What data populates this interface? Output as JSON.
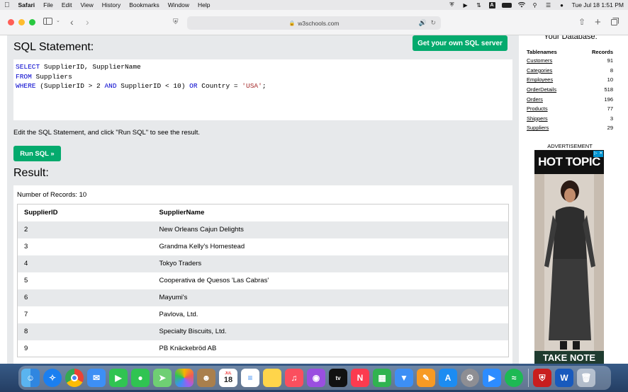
{
  "menubar": {
    "app_name": "Safari",
    "menus": [
      "File",
      "Edit",
      "View",
      "History",
      "Bookmarks",
      "Window",
      "Help"
    ],
    "datetime": "Tue Jul 18  1:51 PM",
    "input_badge": "A"
  },
  "browser": {
    "url": "w3schools.com"
  },
  "page": {
    "sql_title": "SQL Statement:",
    "get_sql_button": "Get your own SQL server",
    "sql_lines": {
      "l1_kw": "SELECT",
      "l1_rest": " SupplierID, SupplierName",
      "l2_kw": "FROM",
      "l2_rest": " Suppliers",
      "l3_kw": "WHERE",
      "l3_a": " (SupplierID > 2 ",
      "l3_and": "AND",
      "l3_b": " SupplierID < 10) ",
      "l3_or": "OR",
      "l3_c": " Country = ",
      "l3_str": "'USA'",
      "l3_end": ";"
    },
    "edit_hint": "Edit the SQL Statement, and click \"Run SQL\" to see the result.",
    "run_button": "Run SQL »",
    "result_title": "Result:",
    "record_count": "Number of Records: 10",
    "result_table": {
      "headers": [
        "SupplierID",
        "SupplierName"
      ],
      "rows": [
        [
          "2",
          "New Orleans Cajun Delights"
        ],
        [
          "3",
          "Grandma Kelly's Homestead"
        ],
        [
          "4",
          "Tokyo Traders"
        ],
        [
          "5",
          "Cooperativa de Quesos 'Las Cabras'"
        ],
        [
          "6",
          "Mayumi's"
        ],
        [
          "7",
          "Pavlova, Ltd."
        ],
        [
          "8",
          "Specialty Biscuits, Ltd."
        ],
        [
          "9",
          "PB Knäckebröd AB"
        ]
      ]
    }
  },
  "sidebar": {
    "title": "Your Database:",
    "headers": [
      "Tablenames",
      "Records"
    ],
    "tables": [
      {
        "name": "Customers",
        "records": "91"
      },
      {
        "name": "Categories",
        "records": "8"
      },
      {
        "name": "Employees",
        "records": "10"
      },
      {
        "name": "OrderDetails",
        "records": "518"
      },
      {
        "name": "Orders",
        "records": "196"
      },
      {
        "name": "Products",
        "records": "77"
      },
      {
        "name": "Shippers",
        "records": "3"
      },
      {
        "name": "Suppliers",
        "records": "29"
      }
    ],
    "ad_label": "ADVERTISEMENT",
    "ad_brand": "HOT TOPIC",
    "ad_bottom_text": "TAKE NOTE"
  },
  "dock": {
    "calendar_day": "18",
    "icons": [
      "finder-icon",
      "safari-icon",
      "chrome-icon",
      "mail-icon",
      "facetime-icon",
      "messages-icon",
      "maps-icon",
      "photos-icon",
      "contacts-icon",
      "calendar-icon",
      "reminders-icon",
      "notes-icon",
      "music-icon",
      "podcasts-icon",
      "appletv-icon",
      "news-icon",
      "numbers-icon",
      "keynote-icon",
      "pages-icon",
      "appstore-icon",
      "systemsettings-icon",
      "zoom-icon",
      "spotify-icon",
      "vpn-icon",
      "word-icon",
      "trash-icon"
    ]
  }
}
